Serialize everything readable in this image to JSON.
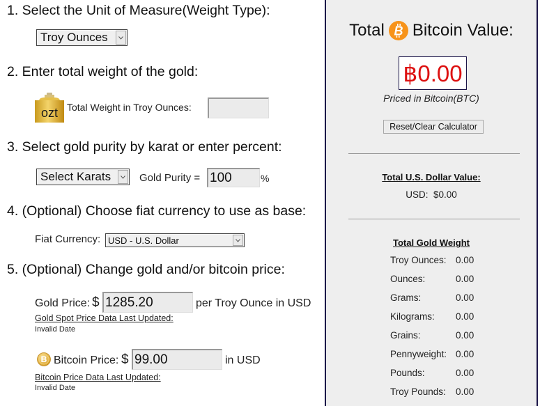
{
  "steps": {
    "s1": "1. Select the Unit of Measure(Weight Type):",
    "s2": "2. Enter total weight of the gold:",
    "s3": "3. Select gold purity by karat or enter percent:",
    "s4": "4. (Optional) Choose fiat currency to use as base:",
    "s5": "5. (Optional) Change gold and/or bitcoin price:"
  },
  "unit_select": {
    "value": "Troy Ounces"
  },
  "weight": {
    "icon_text": "ozt",
    "label": "Total Weight in Troy Ounces:",
    "value": ""
  },
  "purity": {
    "karat_select": "Select Karats",
    "label": "Gold Purity =",
    "value": "100",
    "unit": "%"
  },
  "fiat": {
    "label": "Fiat Currency:",
    "value": "USD - U.S. Dollar"
  },
  "gold_price": {
    "label": "Gold Price:",
    "currency_symbol": "$",
    "value": "1285.20",
    "suffix": "per Troy Ounce in USD",
    "updated_label": "Gold Spot Price Data Last Updated:",
    "updated_value": "Invalid Date"
  },
  "bitcoin_price": {
    "label": "Bitcoin Price:",
    "currency_symbol": "$",
    "value": "99.00",
    "suffix": "in USD",
    "updated_label": "Bitcoin Price Data Last Updated:",
    "updated_value": "Invalid Date"
  },
  "panel": {
    "title_left": "Total",
    "title_right": "Bitcoin Value:",
    "btc_value": "฿0.00",
    "priced_note": "Priced in Bitcoin(BTC)",
    "reset_label": "Reset/Clear Calculator",
    "usd_heading": "Total U.S. Dollar Value:",
    "usd_line": "USD:  $0.00",
    "weight_heading": "Total Gold Weight",
    "weights": [
      {
        "label": "Troy Ounces:",
        "value": "0.00"
      },
      {
        "label": "Ounces:",
        "value": "0.00"
      },
      {
        "label": "Grams:",
        "value": "0.00"
      },
      {
        "label": "Kilograms:",
        "value": "0.00"
      },
      {
        "label": "Grains:",
        "value": "0.00"
      },
      {
        "label": "Pennyweight:",
        "value": "0.00"
      },
      {
        "label": "Pounds:",
        "value": "0.00"
      },
      {
        "label": "Troy Pounds:",
        "value": "0.00"
      }
    ]
  },
  "colors": {
    "btc_value": "#dd1111",
    "panel_bg": "#eeeeee",
    "panel_border": "#1b1548",
    "bitcoin_orange": "#f7931a",
    "gold": "#e8b830"
  }
}
